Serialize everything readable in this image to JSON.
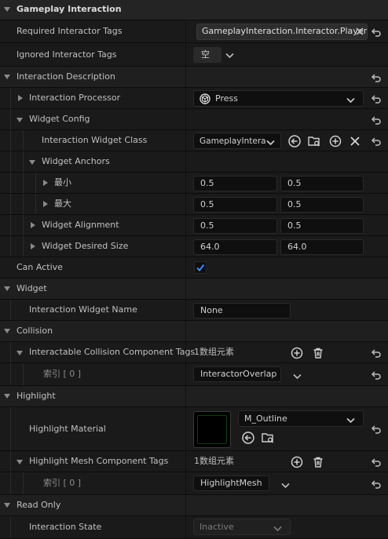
{
  "sections": {
    "gameplay_interaction": "Gameplay Interaction",
    "interaction_description": "Interaction Description",
    "widget": "Widget",
    "collision": "Collision",
    "highlight": "Highlight",
    "read_only": "Read Only"
  },
  "props": {
    "required_tags": {
      "label": "Required Interactor Tags",
      "value": "GameplayInteraction.Interactor.Player"
    },
    "ignored_tags": {
      "label": "Ignored Interactor Tags",
      "value": "空"
    },
    "processor": {
      "label": "Interaction Processor",
      "value": "Press"
    },
    "widget_config": {
      "label": "Widget Config"
    },
    "widget_class": {
      "label": "Interaction Widget Class",
      "value": "GameplayIntera"
    },
    "widget_anchors": {
      "label": "Widget Anchors"
    },
    "anchor_min": {
      "label": "最小",
      "x": "0.5",
      "y": "0.5"
    },
    "anchor_max": {
      "label": "最大",
      "x": "0.5",
      "y": "0.5"
    },
    "widget_alignment": {
      "label": "Widget Alignment",
      "x": "0.5",
      "y": "0.5"
    },
    "widget_size": {
      "label": "Widget Desired Size",
      "x": "64.0",
      "y": "64.0"
    },
    "can_active": {
      "label": "Can Active",
      "checked": true
    },
    "widget_name": {
      "label": "Interaction Widget Name",
      "value": "None"
    },
    "collision_tags": {
      "label": "Interactable Collision Component Tags",
      "count": "1数组元素",
      "index": "索引 [ 0 ]",
      "value": "InteractorOverlap"
    },
    "highlight_material": {
      "label": "Highlight Material",
      "value": "M_Outline"
    },
    "highlight_tags": {
      "label": "Highlight Mesh Component Tags",
      "count": "1数组元素",
      "index": "索引 [ 0 ]",
      "value": "HighlightMesh"
    },
    "interaction_state": {
      "label": "Interaction State",
      "value": "Inactive"
    }
  },
  "colors": {
    "accent": "#2a7fff",
    "checkmark": "#3b8bff"
  }
}
